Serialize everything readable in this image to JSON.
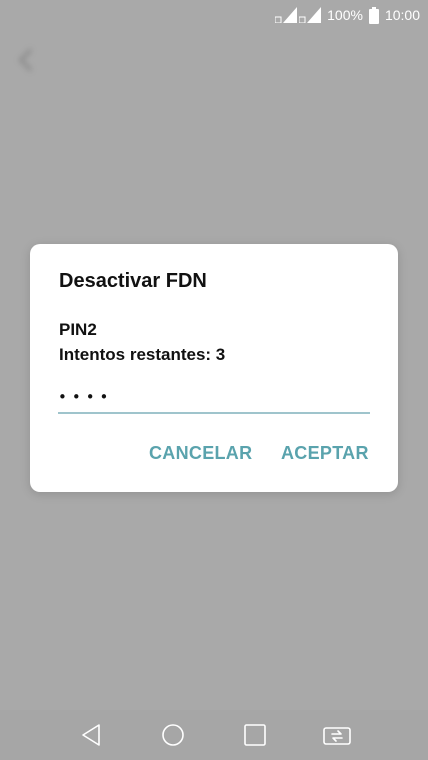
{
  "status_bar": {
    "battery": "100%",
    "time": "10:00"
  },
  "dialog": {
    "title": "Desactivar FDN",
    "pin_label": "PIN2",
    "attempts_label": "Intentos restantes: 3",
    "pin_value": "••••",
    "cancel_label": "CANCELAR",
    "accept_label": "ACEPTAR"
  },
  "colors": {
    "accent": "#5aa3ad",
    "underline": "#9fc4cc",
    "scrim": "#a9a9a9"
  },
  "icons": {
    "status": [
      "signal-icon",
      "signal-icon",
      "battery-icon"
    ],
    "nav": [
      "back-icon",
      "home-icon",
      "recents-icon",
      "dual-window-icon"
    ]
  }
}
